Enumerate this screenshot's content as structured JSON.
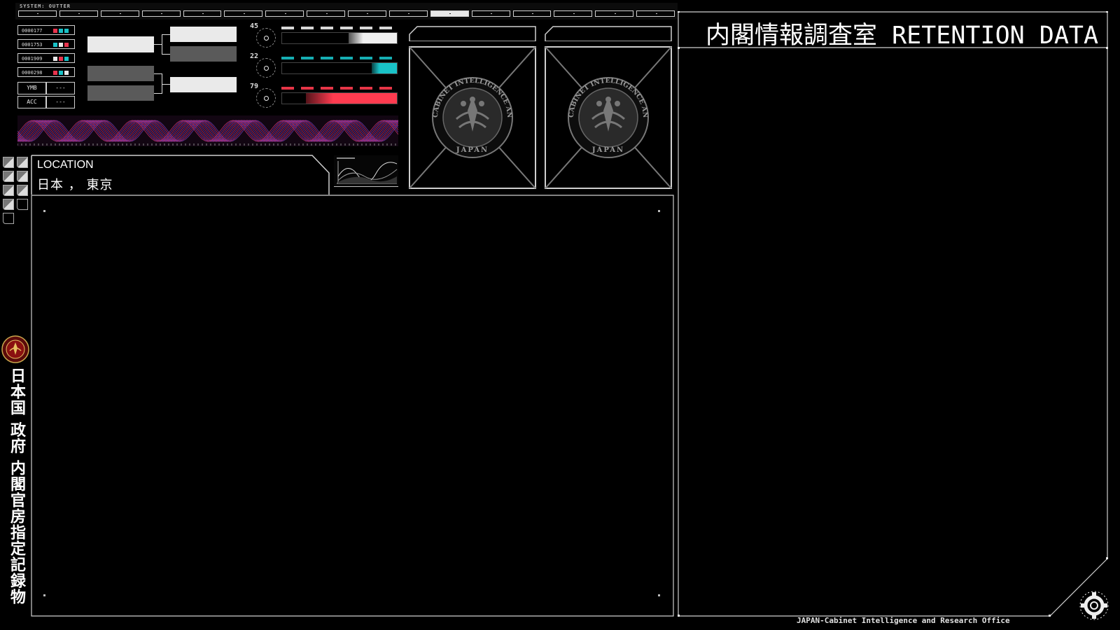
{
  "header": {
    "system_name": "SYSTEM: OUTTER",
    "tab_count": 16,
    "active_tab_index": 10
  },
  "id_list": [
    {
      "id": "0000177",
      "colors": [
        "#e8344e",
        "#19c2c7",
        "#19c2c7"
      ]
    },
    {
      "id": "0001753",
      "colors": [
        "#19c2c7",
        "#e8e8e8",
        "#e8344e"
      ]
    },
    {
      "id": "0001909",
      "colors": [
        "#e8e8e8",
        "#e8344e",
        "#19c2c7"
      ]
    },
    {
      "id": "0000298",
      "colors": [
        "#e8344e",
        "#19c2c7",
        "#e8e8e8"
      ]
    }
  ],
  "fields": [
    {
      "key": "YMB",
      "value": "---"
    },
    {
      "key": "ACC",
      "value": "---"
    }
  ],
  "gauges": [
    {
      "value": "45",
      "color": "#f0f0f0",
      "fill": 0.42
    },
    {
      "value": "22",
      "color": "#19c2c7",
      "fill": 0.22
    },
    {
      "value": "79",
      "color": "#ff3b4f",
      "fill": 0.79
    }
  ],
  "location": {
    "label": "LOCATION",
    "value": "日本 ， 東京"
  },
  "seal_text": {
    "ring": "CABINET INTELLIGENCE AND RESEARCH OFFICE",
    "bottom": "JAPAN"
  },
  "vertical_label": "日本国 政府 内閣官房指定記録物",
  "right_panel": {
    "title": "内閣情報調査室 RETENTION DATA"
  },
  "footer": "JAPAN-Cabinet Intelligence and Research Office",
  "colors": {
    "accent_red": "#ff3b4f",
    "accent_cyan": "#19c2c7",
    "accent_white": "#f0f0f0",
    "line": "#cfcfcf"
  }
}
